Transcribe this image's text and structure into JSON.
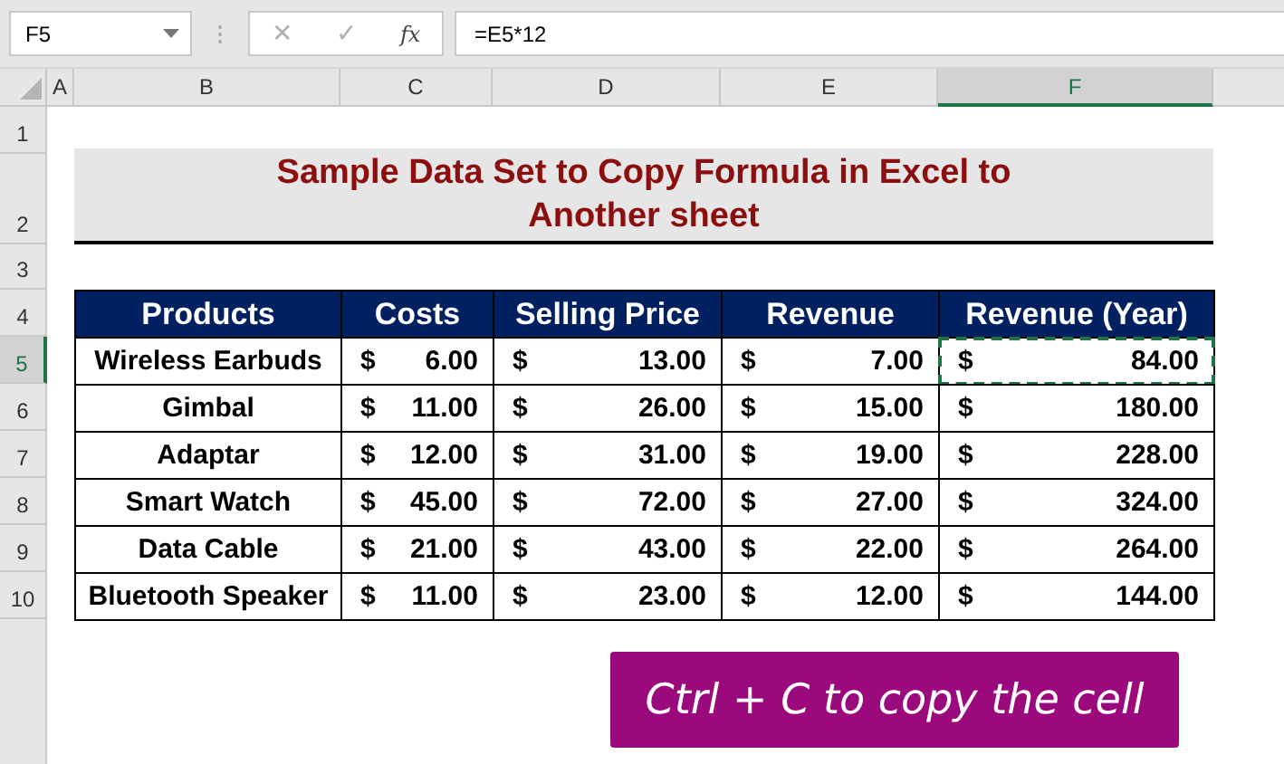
{
  "formula_bar": {
    "name_box": "F5",
    "cancel_symbol": "✕",
    "enter_symbol": "✓",
    "function_symbol": "fx",
    "formula": "=E5*12"
  },
  "column_headers": [
    {
      "label": "A",
      "selected": false
    },
    {
      "label": "B",
      "selected": false
    },
    {
      "label": "C",
      "selected": false
    },
    {
      "label": "D",
      "selected": false
    },
    {
      "label": "E",
      "selected": false
    },
    {
      "label": "F",
      "selected": true
    }
  ],
  "row_headers": [
    {
      "label": "1",
      "selected": false
    },
    {
      "label": "2",
      "selected": false
    },
    {
      "label": "3",
      "selected": false
    },
    {
      "label": "4",
      "selected": false
    },
    {
      "label": "5",
      "selected": true
    },
    {
      "label": "6",
      "selected": false
    },
    {
      "label": "7",
      "selected": false
    },
    {
      "label": "8",
      "selected": false
    },
    {
      "label": "9",
      "selected": false
    },
    {
      "label": "10",
      "selected": false
    }
  ],
  "title": "Sample Data Set to Copy Formula in Excel to Another sheet",
  "table": {
    "columns": [
      "Products",
      "Costs",
      "Selling Price",
      "Revenue",
      "Revenue (Year)"
    ],
    "rows": [
      {
        "product": "Wireless Earbuds",
        "values": [
          {
            "symbol": "$",
            "amount": "6.00"
          },
          {
            "symbol": "$",
            "amount": "13.00"
          },
          {
            "symbol": "$",
            "amount": "7.00"
          },
          {
            "symbol": "$",
            "amount": "84.00"
          }
        ],
        "copied": true
      },
      {
        "product": "Gimbal",
        "values": [
          {
            "symbol": "$",
            "amount": "11.00"
          },
          {
            "symbol": "$",
            "amount": "26.00"
          },
          {
            "symbol": "$",
            "amount": "15.00"
          },
          {
            "symbol": "$",
            "amount": "180.00"
          }
        ],
        "copied": false
      },
      {
        "product": "Adaptar",
        "values": [
          {
            "symbol": "$",
            "amount": "12.00"
          },
          {
            "symbol": "$",
            "amount": "31.00"
          },
          {
            "symbol": "$",
            "amount": "19.00"
          },
          {
            "symbol": "$",
            "amount": "228.00"
          }
        ],
        "copied": false
      },
      {
        "product": "Smart Watch",
        "values": [
          {
            "symbol": "$",
            "amount": "45.00"
          },
          {
            "symbol": "$",
            "amount": "72.00"
          },
          {
            "symbol": "$",
            "amount": "27.00"
          },
          {
            "symbol": "$",
            "amount": "324.00"
          }
        ],
        "copied": false
      },
      {
        "product": "Data Cable",
        "values": [
          {
            "symbol": "$",
            "amount": "21.00"
          },
          {
            "symbol": "$",
            "amount": "43.00"
          },
          {
            "symbol": "$",
            "amount": "22.00"
          },
          {
            "symbol": "$",
            "amount": "264.00"
          }
        ],
        "copied": false
      },
      {
        "product": "Bluetooth Speaker",
        "values": [
          {
            "symbol": "$",
            "amount": "11.00"
          },
          {
            "symbol": "$",
            "amount": "23.00"
          },
          {
            "symbol": "$",
            "amount": "12.00"
          },
          {
            "symbol": "$",
            "amount": "144.00"
          }
        ],
        "copied": false
      }
    ]
  },
  "callout": "Ctrl + C to copy the cell"
}
